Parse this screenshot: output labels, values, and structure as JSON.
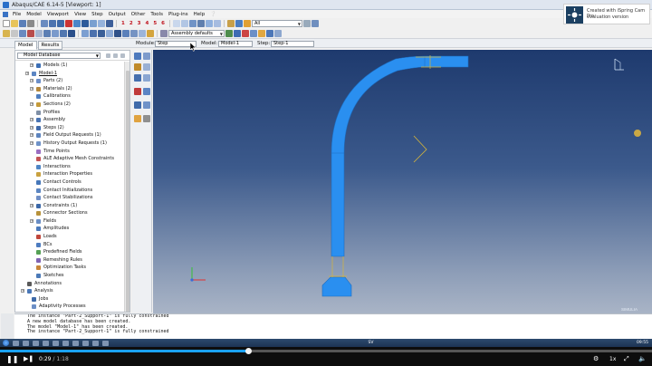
{
  "window": {
    "title": "Abaqus/CAE 6.14-5 [Viewport: 1]"
  },
  "menu": [
    "File",
    "Model",
    "Viewport",
    "View",
    "Step",
    "Output",
    "Other",
    "Tools",
    "Plug-ins",
    "Help"
  ],
  "toolbar": {
    "numbers": [
      "1",
      "2",
      "3",
      "4",
      "5",
      "6"
    ],
    "filter_value": "All",
    "display_group": "Assembly defaults"
  },
  "context": {
    "tabs": [
      "Model",
      "Results"
    ],
    "module_label": "Module:",
    "module_value": "Step",
    "model_label": "Model:",
    "model_value": "Model-1",
    "step_label": "Step:",
    "step_value": "Step-1"
  },
  "tree": {
    "database_combo": "Model Database",
    "items": [
      {
        "label": "Models (1)"
      },
      {
        "label": "Model-1"
      },
      {
        "label": "Parts (2)"
      },
      {
        "label": "Materials (2)"
      },
      {
        "label": "Calibrations"
      },
      {
        "label": "Sections (2)"
      },
      {
        "label": "Profiles"
      },
      {
        "label": "Assembly"
      },
      {
        "label": "Steps (2)"
      },
      {
        "label": "Field Output Requests (1)"
      },
      {
        "label": "History Output Requests (1)"
      },
      {
        "label": "Time Points"
      },
      {
        "label": "ALE Adaptive Mesh Constraints"
      },
      {
        "label": "Interactions"
      },
      {
        "label": "Interaction Properties"
      },
      {
        "label": "Contact Controls"
      },
      {
        "label": "Contact Initializations"
      },
      {
        "label": "Contact Stabilizations"
      },
      {
        "label": "Constraints (1)"
      },
      {
        "label": "Connector Sections"
      },
      {
        "label": "Fields"
      },
      {
        "label": "Amplitudes"
      },
      {
        "label": "Loads"
      },
      {
        "label": "BCs"
      },
      {
        "label": "Predefined Fields"
      },
      {
        "label": "Remeshing Rules"
      },
      {
        "label": "Optimization Tasks"
      },
      {
        "label": "Sketches"
      },
      {
        "label": "Annotations"
      },
      {
        "label": "Analysis"
      },
      {
        "label": "Jobs"
      },
      {
        "label": "Adaptivity Processes"
      }
    ]
  },
  "messages": [
    "The instance \"Part-2_Support-1\" is fully constrained",
    "A new model database has been created.",
    "The model \"Model-1\" has been created.",
    "The instance \"Part-2_Support-1\" is fully constrained"
  ],
  "viewport": {
    "brand": "SIMULIA",
    "part_color": "#2a8ff0"
  },
  "overlay": {
    "line1": "Created with iSpring Cam Pro",
    "line2": "evaluation version"
  },
  "taskbar": {
    "clock": "09:55",
    "lang": "SV"
  },
  "player": {
    "current": "0:29",
    "total": "/ 1:18",
    "progress": 0.38,
    "speed": "1x"
  }
}
